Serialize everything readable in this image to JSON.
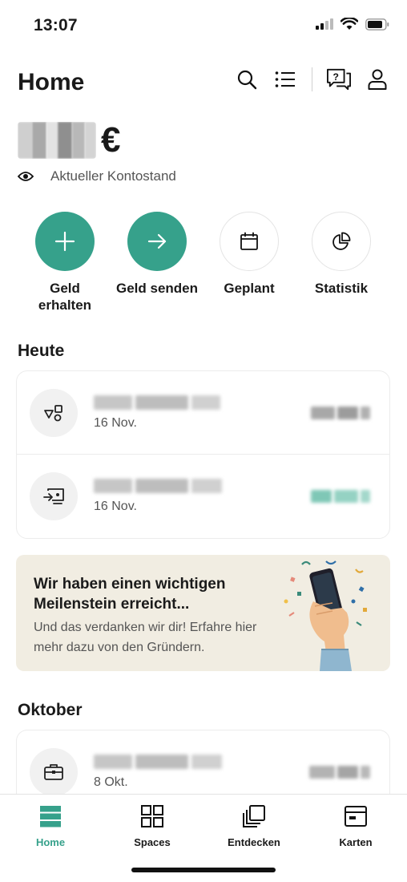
{
  "status_bar": {
    "time": "13:07"
  },
  "header": {
    "title": "Home"
  },
  "balance": {
    "currency": "€",
    "caption": "Aktueller Kontostand"
  },
  "actions": [
    {
      "label": "Geld\nerhalten",
      "icon": "plus-icon"
    },
    {
      "label": "Geld senden",
      "icon": "arrow-right-icon"
    },
    {
      "label": "Geplant",
      "icon": "calendar-icon"
    },
    {
      "label": "Statistik",
      "icon": "pie-chart-icon"
    }
  ],
  "sections": {
    "today": {
      "title": "Heute",
      "transactions": [
        {
          "date": "16 Nov.",
          "icon": "shapes-icon",
          "amount_color": "#9a9a9a"
        },
        {
          "date": "16 Nov.",
          "icon": "transfer-screen-icon",
          "amount_color": "#7fc7b6"
        }
      ]
    },
    "october": {
      "title": "Oktober",
      "transactions": [
        {
          "date": "8 Okt.",
          "icon": "briefcase-icon",
          "amount_color": "#9a9a9a"
        }
      ]
    }
  },
  "promo": {
    "title": "Wir haben einen wichtigen Meilenstein erreicht...",
    "body": "Und das verdanken wir dir! Erfahre hier mehr dazu von den Gründern."
  },
  "tab_bar": {
    "items": [
      {
        "label": "Home",
        "active": true,
        "icon": "home-stack-icon"
      },
      {
        "label": "Spaces",
        "active": false,
        "icon": "grid-icon"
      },
      {
        "label": "Entdecken",
        "active": false,
        "icon": "cards-stack-icon"
      },
      {
        "label": "Karten",
        "active": false,
        "icon": "card-icon"
      }
    ]
  },
  "colors": {
    "accent": "#36a18b",
    "promo_bg": "#f1ede2"
  }
}
